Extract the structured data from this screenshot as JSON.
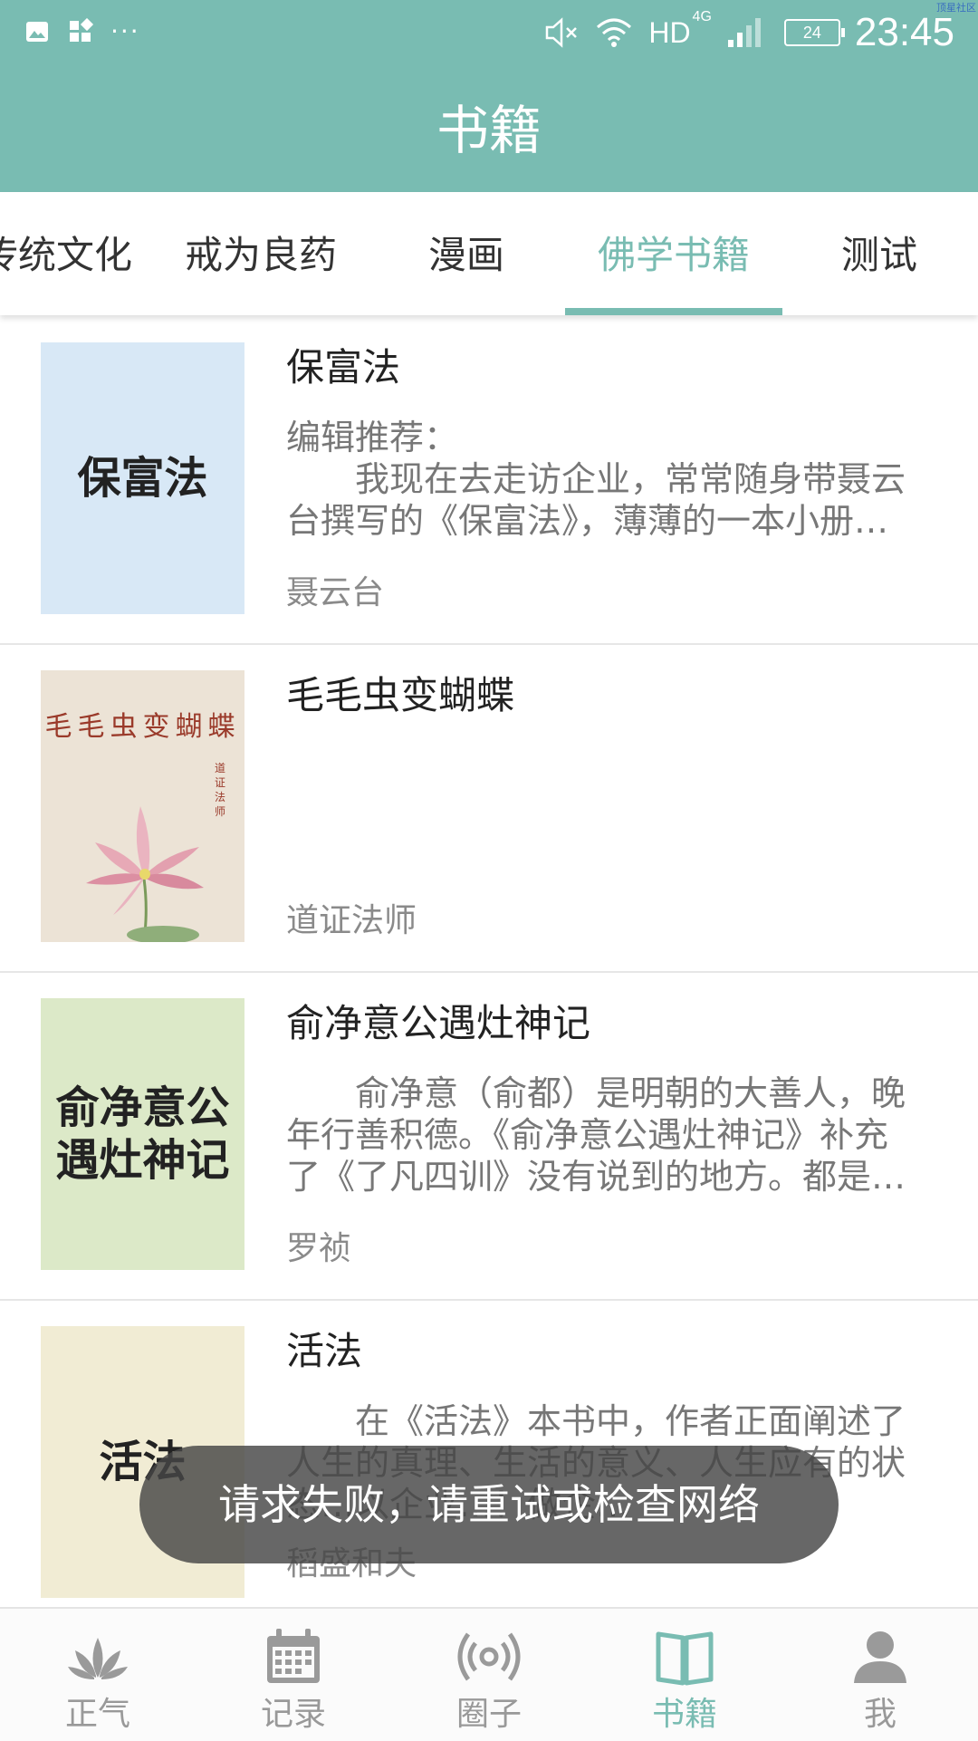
{
  "status_bar": {
    "time": "23:45",
    "network": "HD",
    "network_gen": "4G",
    "battery": "24",
    "dots": "···",
    "corner_text": "顶星社区"
  },
  "header": {
    "title": "书籍"
  },
  "tabs": [
    {
      "label": "传统文化"
    },
    {
      "label": "戒为良药"
    },
    {
      "label": "漫画"
    },
    {
      "label": "佛学书籍",
      "active": true
    },
    {
      "label": "测试"
    }
  ],
  "books": [
    {
      "cover_text": "保富法",
      "cover_color": "#d8e8f6",
      "title": "保富法",
      "description": "编辑推荐：\n　　我现在去走访企业，常常随身带聂云台撰写的《保富法》，薄薄的一本小册…",
      "author": "聂云台"
    },
    {
      "cover_text": "毛毛虫变蝴蝶",
      "cover_sub": "道证法师",
      "cover_color": "#ece3d6",
      "title": "毛毛虫变蝴蝶",
      "description": "",
      "author": "道证法师"
    },
    {
      "cover_text": "俞净意公遇灶神记",
      "cover_color": "#dce9c8",
      "title": "俞净意公遇灶神记",
      "description": "　　俞净意（俞都）是明朝的大善人，晚年行善积德。《俞净意公遇灶神记》补充了《了凡四训》没有说到的地方。都是…",
      "author": "罗祯"
    },
    {
      "cover_text": "活法",
      "cover_color": "#f1ecd4",
      "title": "活法",
      "description": "　　在《活法》本书中，作者正面阐述了人生的真理、生活的意义、人生应有的状态…以企业…！做企…",
      "author": "稻盛和夫"
    }
  ],
  "toast": {
    "message": "请求失败，请重试或检查网络"
  },
  "bottom_nav": [
    {
      "label": "正气",
      "icon": "lotus-icon"
    },
    {
      "label": "记录",
      "icon": "calendar-icon"
    },
    {
      "label": "圈子",
      "icon": "broadcast-icon"
    },
    {
      "label": "书籍",
      "icon": "book-icon",
      "active": true
    },
    {
      "label": "我",
      "icon": "person-icon"
    }
  ],
  "colors": {
    "accent": "#79bcb2",
    "inactive": "#999999"
  }
}
